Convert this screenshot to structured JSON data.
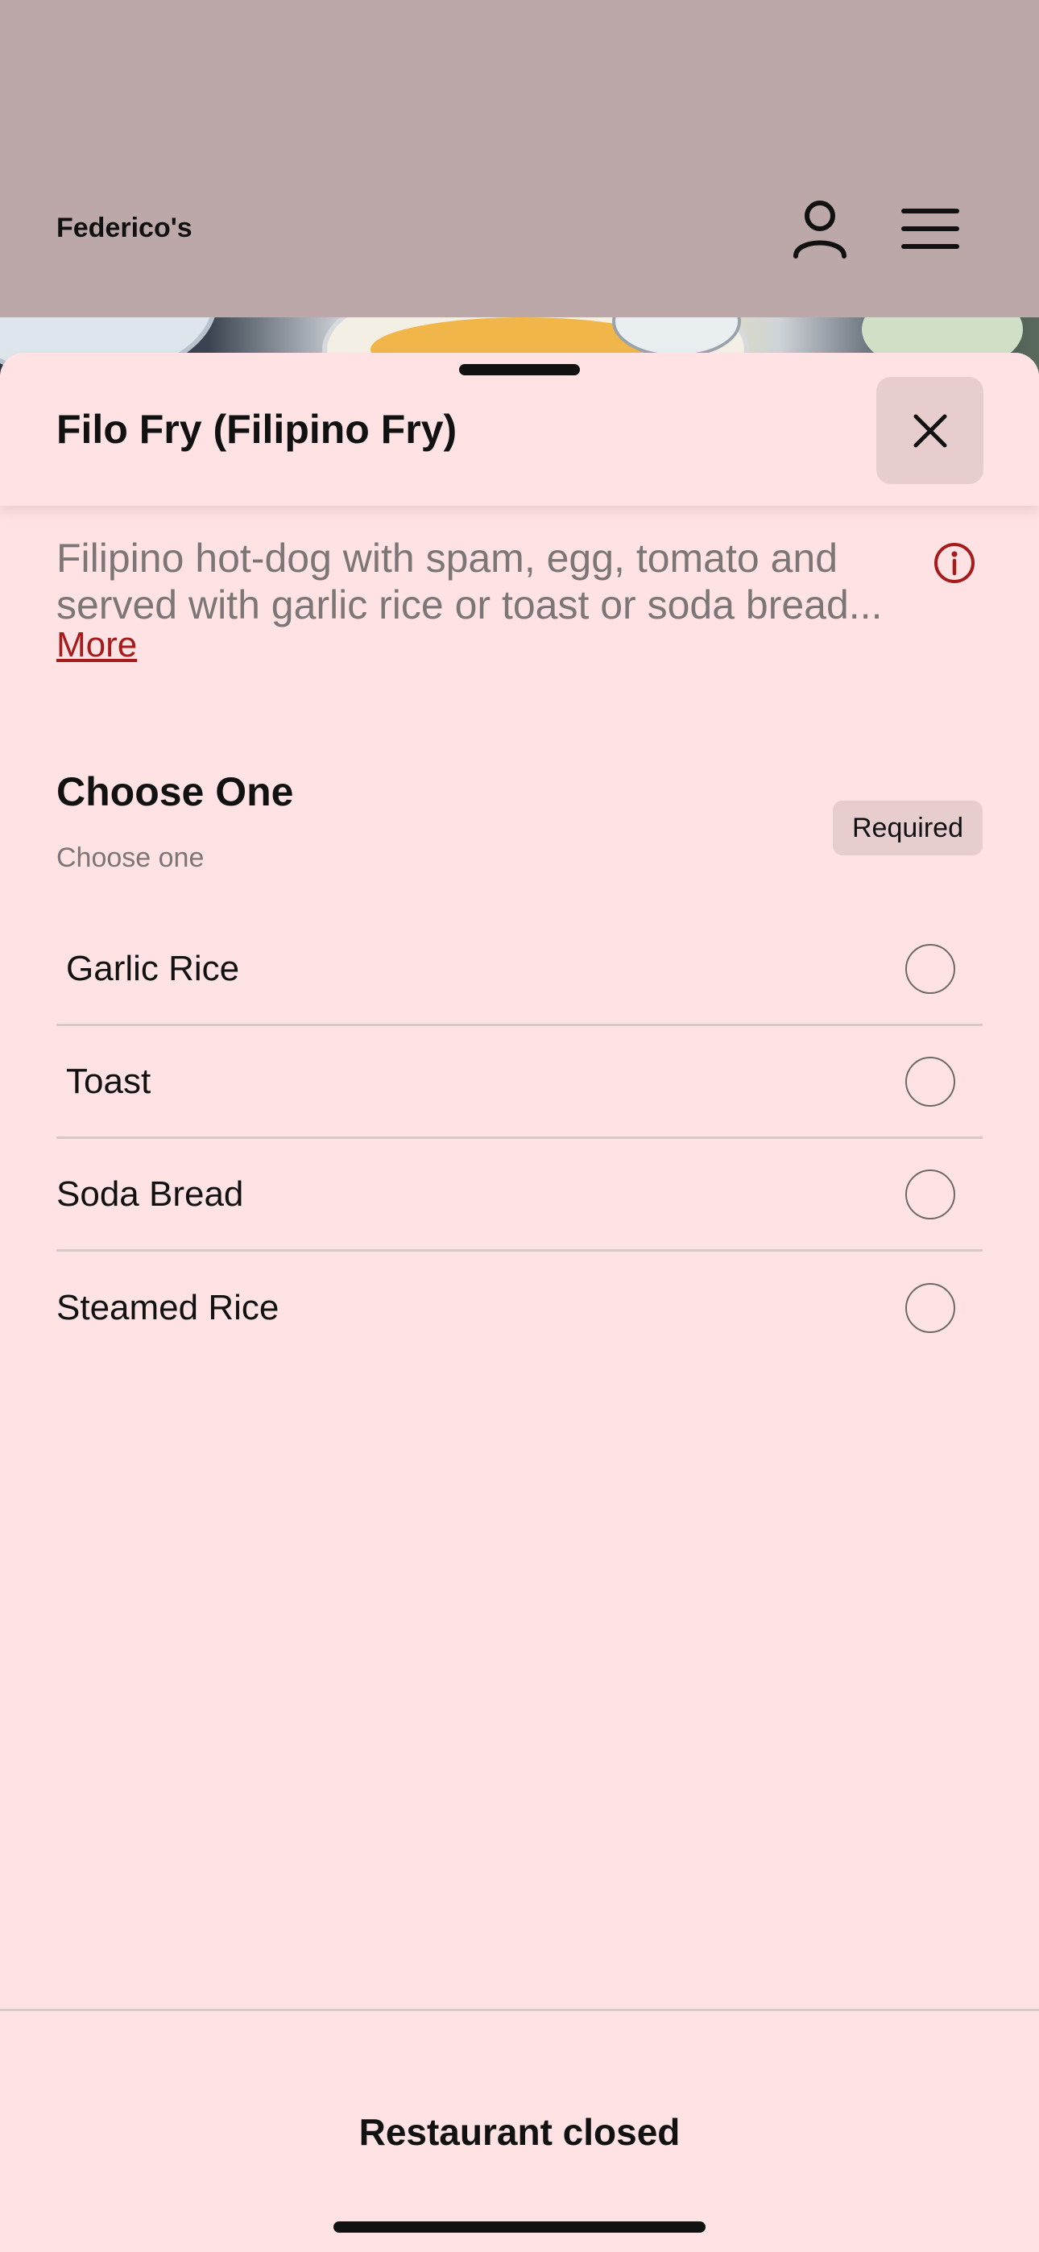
{
  "header": {
    "brand": "Federico's",
    "profile_icon": "person-icon",
    "menu_icon": "hamburger-menu-icon"
  },
  "item": {
    "title": "Filo Fry (Filipino Fry)",
    "description_line1": "Filipino hot-dog with spam, egg, tomato and",
    "description_line2": "served with garlic rice or toast or soda bread...",
    "more_label": "More",
    "close_icon": "close-icon",
    "info_icon": "info-icon"
  },
  "modifier_group": {
    "title": "Choose One",
    "subtitle": "Choose one",
    "badge": "Required",
    "options": [
      {
        "label": "Garlic Rice",
        "selected": false
      },
      {
        "label": "Toast",
        "selected": false
      },
      {
        "label": "Soda Bread",
        "selected": false
      },
      {
        "label": "Steamed Rice",
        "selected": false
      }
    ]
  },
  "footer": {
    "status": "Restaurant closed"
  },
  "colors": {
    "sheet_bg": "#ffe2e3",
    "header_bg": "#bca8a8",
    "accent": "#a61b1b",
    "badge_bg": "#e7cdcd"
  }
}
